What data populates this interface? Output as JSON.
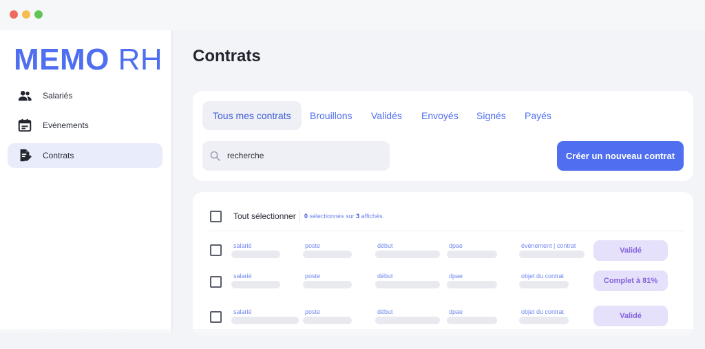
{
  "app": {
    "brand_bold": "MEMO",
    "brand_light": "RH",
    "accent": "#4f6ef0"
  },
  "sidebar": {
    "items": [
      {
        "label": "Salariés",
        "icon": "people-icon",
        "active": false
      },
      {
        "label": "Evènements",
        "icon": "calendar-icon",
        "active": false
      },
      {
        "label": "Contrats",
        "icon": "document-edit-icon",
        "active": true
      }
    ]
  },
  "main": {
    "title": "Contrats",
    "tabs": [
      {
        "label": "Tous mes contrats",
        "active": true
      },
      {
        "label": "Brouillons"
      },
      {
        "label": "Validés"
      },
      {
        "label": "Envoyés"
      },
      {
        "label": "Signés"
      },
      {
        "label": "Payés"
      }
    ],
    "search": {
      "value": "recherche",
      "icon": "search-icon"
    },
    "create_button": "Créer un nouveau contrat"
  },
  "list": {
    "select_all": "Tout sélectionner",
    "selected_count": "0",
    "selected_mid": "sélectionnés sur",
    "shown_count": "3",
    "shown_suffix": "affichés.",
    "rows": [
      {
        "salarie": "salarié",
        "poste": "poste",
        "debut": "début",
        "dpae": "dpae",
        "extra": "évènement | contrat",
        "status": "Validé"
      },
      {
        "salarie": "salarié",
        "poste": "poste",
        "debut": "début",
        "dpae": "dpae",
        "extra": "objet du contrat",
        "status": "Complet à 81%"
      },
      {
        "salarie": "salarié",
        "poste": "poste",
        "debut": "début",
        "dpae": "dpae",
        "extra": "objet du contrat",
        "status": "Validé"
      }
    ]
  },
  "colors": {
    "status_bg": "#e6e1fb",
    "status_text": "#8562dc",
    "active_nav": "#e9ecfb"
  }
}
